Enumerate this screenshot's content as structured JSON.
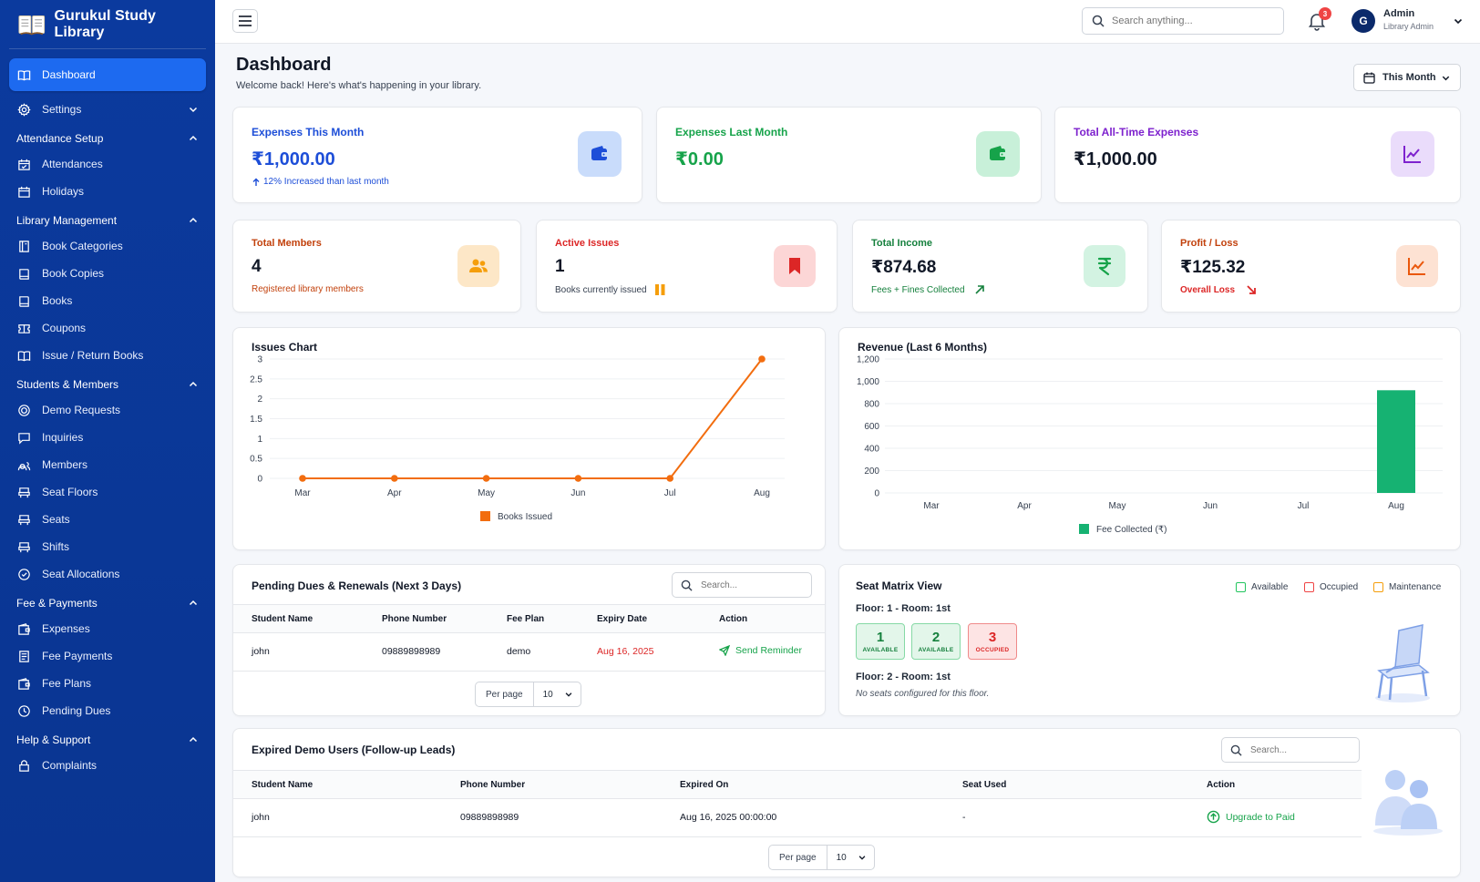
{
  "brand": {
    "name": "Gurukul Study Library"
  },
  "sidebar": {
    "dashboard": "Dashboard",
    "settings": "Settings",
    "sections": [
      {
        "title": "Attendance Setup",
        "items": [
          "Attendances",
          "Holidays"
        ]
      },
      {
        "title": "Library Management",
        "items": [
          "Book Categories",
          "Book Copies",
          "Books",
          "Coupons",
          "Issue / Return Books"
        ]
      },
      {
        "title": "Students & Members",
        "items": [
          "Demo Requests",
          "Inquiries",
          "Members",
          "Seat Floors",
          "Seats",
          "Shifts",
          "Seat Allocations"
        ]
      },
      {
        "title": "Fee & Payments",
        "items": [
          "Expenses",
          "Fee Payments",
          "Fee Plans",
          "Pending Dues"
        ]
      },
      {
        "title": "Help & Support",
        "items": [
          "Complaints"
        ]
      }
    ]
  },
  "topbar": {
    "search_placeholder": "Search anything...",
    "notif_count": "3",
    "avatar_letter": "G",
    "user_name": "Admin",
    "user_role": "Library Admin"
  },
  "header": {
    "title": "Dashboard",
    "subtitle": "Welcome back! Here's what's happening in your library.",
    "period": "This Month"
  },
  "stats_top": [
    {
      "label": "Expenses This Month",
      "value": "₹1,000.00",
      "note": "12% Increased than last month",
      "color": "#1d4ed8",
      "icon": "wallet-icon"
    },
    {
      "label": "Expenses Last Month",
      "value": "₹0.00",
      "note": "",
      "color": "#16a34a",
      "icon": "wallet-icon"
    },
    {
      "label": "Total All-Time Expenses",
      "value": "₹1,000.00",
      "note": "",
      "color": "#7e22ce",
      "icon": "trend-chart-icon"
    }
  ],
  "stats_mid": [
    {
      "label": "Total Members",
      "value": "4",
      "note": "Registered library members",
      "color": "#c2410c",
      "icon": "users-icon"
    },
    {
      "label": "Active Issues",
      "value": "1",
      "note": "Books currently issued",
      "color": "#dc2626",
      "icon": "bookmark-icon"
    },
    {
      "label": "Total Income",
      "value": "₹874.68",
      "note": "Fees + Fines Collected",
      "color": "#15803d",
      "icon": "rupee-icon"
    },
    {
      "label": "Profit / Loss",
      "value": "₹125.32",
      "note": "Overall Loss",
      "color": "#c2410c",
      "icon": "trend-chart-icon"
    }
  ],
  "issues_chart": {
    "title": "Issues Chart",
    "chart_data": {
      "type": "line",
      "title": "Issues Chart",
      "categories": [
        "Mar",
        "Apr",
        "May",
        "Jun",
        "Jul",
        "Aug"
      ],
      "series": [
        {
          "name": "Books Issued",
          "values": [
            0,
            0,
            0,
            0,
            0,
            3
          ]
        }
      ],
      "yticks": [
        "0",
        "0.5",
        "1",
        "1.5",
        "2",
        "2.5",
        "3"
      ],
      "ylim": [
        0,
        3
      ],
      "grid": true,
      "legend": "bottom",
      "color": "#f26d0f"
    }
  },
  "revenue_chart": {
    "title": "Revenue (Last 6 Months)",
    "chart_data": {
      "type": "bar",
      "title": "Revenue (Last 6 Months)",
      "categories": [
        "Mar",
        "Apr",
        "May",
        "Jun",
        "Jul",
        "Aug"
      ],
      "series": [
        {
          "name": "Fee Collected (₹)",
          "values": [
            0,
            0,
            0,
            0,
            0,
            920
          ]
        }
      ],
      "yticks": [
        "0",
        "200",
        "400",
        "600",
        "800",
        "1,000",
        "1,200"
      ],
      "ylim": [
        0,
        1200
      ],
      "grid": true,
      "legend": "bottom",
      "color": "#16b272"
    }
  },
  "pending": {
    "title": "Pending Dues & Renewals (Next 3 Days)",
    "search_placeholder": "Search...",
    "columns": [
      "Student Name",
      "Phone Number",
      "Fee Plan",
      "Expiry Date",
      "Action"
    ],
    "rows": [
      {
        "name": "john",
        "phone": "09889898989",
        "plan": "demo",
        "expiry": "Aug 16, 2025",
        "action": "Send Reminder"
      }
    ],
    "per_page_label": "Per page",
    "per_page": "10"
  },
  "seat_matrix": {
    "title": "Seat Matrix View",
    "legend": [
      "Available",
      "Occupied",
      "Maintenance"
    ],
    "floors": [
      {
        "label": "Floor: 1 - Room: 1st",
        "seats": [
          {
            "num": "1",
            "status": "AVAILABLE"
          },
          {
            "num": "2",
            "status": "AVAILABLE"
          },
          {
            "num": "3",
            "status": "OCCUPIED"
          }
        ]
      },
      {
        "label": "Floor: 2 - Room: 1st",
        "empty": "No seats configured for this floor."
      }
    ]
  },
  "expired": {
    "title": "Expired Demo Users (Follow-up Leads)",
    "search_placeholder": "Search...",
    "columns": [
      "Student Name",
      "Phone Number",
      "Expired On",
      "Seat Used",
      "Action"
    ],
    "rows": [
      {
        "name": "john",
        "phone": "09889898989",
        "expired_on": "Aug 16, 2025 00:00:00",
        "seat": "-",
        "action": "Upgrade to Paid"
      }
    ],
    "per_page_label": "Per page",
    "per_page": "10"
  },
  "colors": {
    "sidebar": "#0b3a9e",
    "accent": "#1d6af0"
  }
}
